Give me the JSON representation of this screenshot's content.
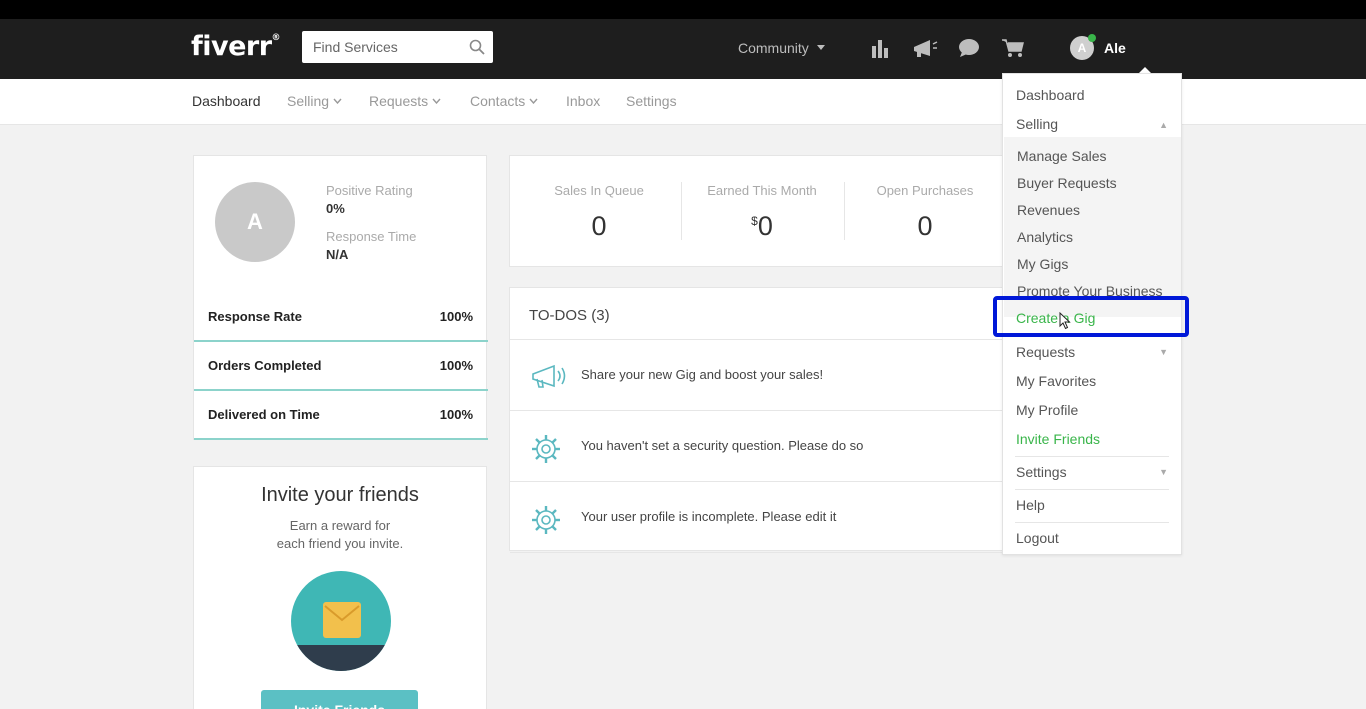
{
  "header": {
    "logo": "fiverr",
    "search_placeholder": "Find Services",
    "community_label": "Community",
    "user_initial": "A",
    "username": "Ale"
  },
  "subnav": {
    "items": [
      {
        "label": "Dashboard",
        "dropdown": false
      },
      {
        "label": "Selling",
        "dropdown": true
      },
      {
        "label": "Requests",
        "dropdown": true
      },
      {
        "label": "Contacts",
        "dropdown": true
      },
      {
        "label": "Inbox",
        "dropdown": false
      },
      {
        "label": "Settings",
        "dropdown": false
      }
    ]
  },
  "profile": {
    "initial": "A",
    "positive_rating_label": "Positive Rating",
    "positive_rating_value": "0%",
    "response_time_label": "Response Time",
    "response_time_value": "N/A",
    "stats": [
      {
        "label": "Response Rate",
        "value": "100%"
      },
      {
        "label": "Orders Completed",
        "value": "100%"
      },
      {
        "label": "Delivered on Time",
        "value": "100%"
      }
    ]
  },
  "invite": {
    "title": "Invite your friends",
    "sub_line1": "Earn a reward for",
    "sub_line2": "each friend you invite.",
    "button": "Invite Friends"
  },
  "sales": {
    "items": [
      {
        "label": "Sales In Queue",
        "value": "0",
        "prefix": ""
      },
      {
        "label": "Earned This Month",
        "value": "0",
        "prefix": "$"
      },
      {
        "label": "Open Purchases",
        "value": "0",
        "prefix": ""
      }
    ]
  },
  "todos": {
    "title": "TO-DOS (3)",
    "items": [
      {
        "text": "Share your new Gig and boost your sales!",
        "icon": "megaphone-icon"
      },
      {
        "text": "You haven't set a security question. Please do so",
        "icon": "gear-icon"
      },
      {
        "text": "Your user profile is incomplete. Please edit it",
        "icon": "gear-icon"
      }
    ]
  },
  "dropdown": {
    "dashboard": "Dashboard",
    "selling": "Selling",
    "selling_items": [
      "Manage Sales",
      "Buyer Requests",
      "Revenues",
      "Analytics",
      "My Gigs",
      "Promote Your Business",
      "Create a Gig"
    ],
    "requests": "Requests",
    "my_favorites": "My Favorites",
    "my_profile": "My Profile",
    "invite_friends": "Invite Friends",
    "settings": "Settings",
    "help": "Help",
    "logout": "Logout",
    "highlighted_item": "Create a Gig"
  },
  "colors": {
    "header_bg": "#1e1e1e",
    "green": "#39b54a",
    "teal": "#3fb7b5",
    "highlight_border": "#0018d8"
  }
}
